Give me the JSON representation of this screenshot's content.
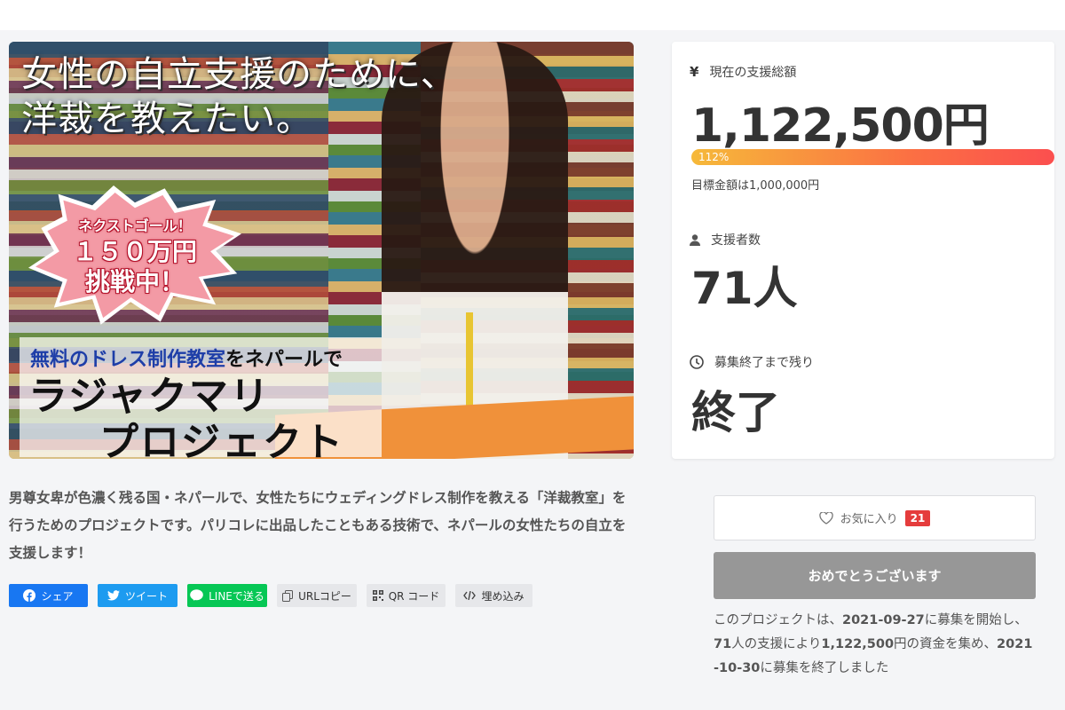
{
  "hero": {
    "title_line1": "女性の自立支援のために、",
    "title_line2": "洋裁を教えたい。",
    "burst_line1": "ネクストゴール！",
    "burst_line2": "１５０万円",
    "burst_line3": "挑戦中！",
    "subtitle_a": "無料のドレス制作教室",
    "subtitle_b": "をネパールで",
    "project_line1": "ラジャクマリ",
    "project_line2": "プロジェクト"
  },
  "description": "男尊女卑が色濃く残る国・ネパールで、女性たちにウェディングドレス制作を教える「洋裁教室」を行うためのプロジェクトです。パリコレに出品したこともある技術で、ネパールの女性たちの自立を支援します！",
  "share": {
    "facebook": "シェア",
    "twitter": "ツイート",
    "line": "LINEで送る",
    "url_copy": "URLコピー",
    "qr": "QR コード",
    "embed": "埋め込み"
  },
  "stats": {
    "amount_label": "現在の支援総額",
    "amount_value": "1,122,500円",
    "progress_text": "112%",
    "progress_fraction": 1.0,
    "goal_text": "目標金額は1,000,000円",
    "supporters_label": "支援者数",
    "supporters_value": "71人",
    "remaining_label": "募集終了まで残り",
    "remaining_value": "終了"
  },
  "actions": {
    "favorite_label": "お気に入り",
    "favorite_count": "21",
    "done_label": "おめでとうございます"
  },
  "summary": {
    "part1": "このプロジェクトは、",
    "start_date": "2021-09-27",
    "part2": "に募集を開始し、",
    "supporters": "71",
    "part3": "人の支援により",
    "amount": "1,122,500",
    "part4": "円の資金を集め、",
    "end_date": "2021-10-30",
    "part5": "に募集を終了しました"
  },
  "colors": {
    "facebook": "#1877f2",
    "twitter": "#1d9bf0",
    "line": "#06c755",
    "progress_start": "#f6b93a",
    "progress_end": "#fb4f4f",
    "badge": "#e53c3c"
  }
}
